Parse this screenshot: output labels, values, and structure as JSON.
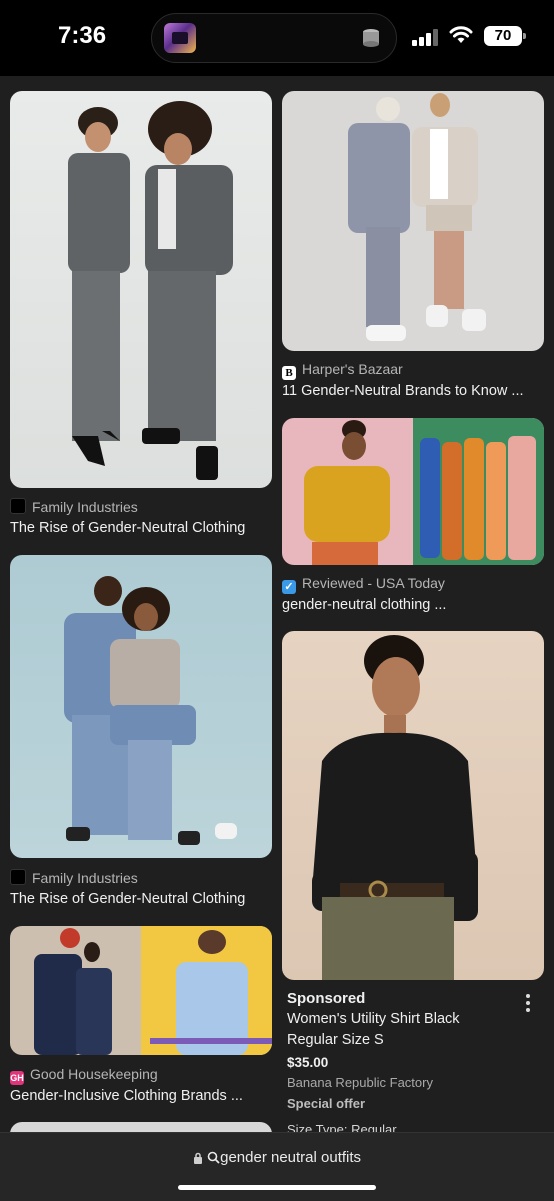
{
  "status": {
    "time": "7:36",
    "battery": "70"
  },
  "results": [
    {
      "source": "Family Industries",
      "title": "The Rise of Gender-Neutral Clothing"
    },
    {
      "source": "Harper's Bazaar",
      "favicon": "B",
      "title": "11 Gender-Neutral Brands to Know ..."
    },
    {
      "source": "Reviewed - USA Today",
      "title": "gender-neutral clothing ..."
    },
    {
      "source": "Family Industries",
      "title": "The Rise of Gender-Neutral Clothing"
    },
    {
      "source": "Good Housekeeping",
      "favicon": "GH",
      "title": "Gender-Inclusive Clothing Brands ..."
    }
  ],
  "sponsored": {
    "label": "Sponsored",
    "product_line1": "Women's Utility Shirt Black",
    "product_line2": "Regular Size S",
    "price": "$35.00",
    "store": "Banana Republic Factory",
    "offer": "Special offer",
    "size_type": "Size Type: Regular"
  },
  "search": {
    "query": "gender neutral outfits"
  },
  "icons": {
    "menu": "more-vert-icon",
    "lock": "lock-icon",
    "search": "search-icon"
  },
  "colors": {
    "background": "#1f1f1f",
    "checkmark_favicon": "#3b9ae8",
    "gh_favicon": "#e0357a"
  }
}
